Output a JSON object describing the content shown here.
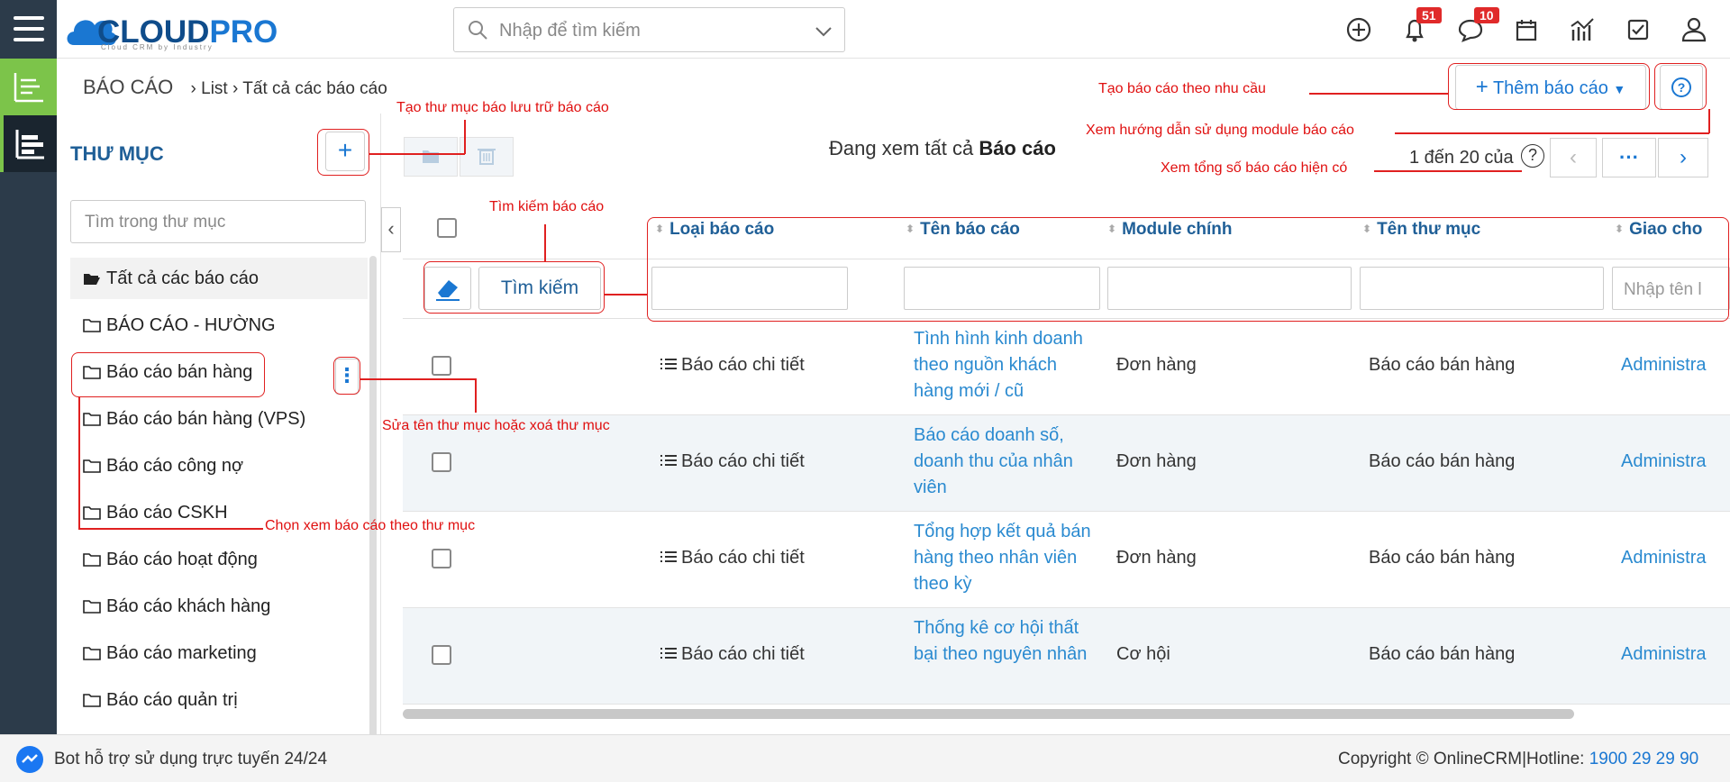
{
  "app": {
    "logo_main": "CLOUD",
    "logo_accent": "PRO",
    "logo_sub": "Cloud CRM by Industry"
  },
  "search": {
    "placeholder": "Nhập để tìm kiếm"
  },
  "top_icons": {
    "notifications_count": "51",
    "messages_count": "10"
  },
  "breadcrumb": {
    "module": "BÁO CÁO",
    "items": [
      "List",
      "Tất cả các báo cáo"
    ]
  },
  "sidebar": {
    "title": "THƯ MỤC",
    "add_label": "+",
    "search_placeholder": "Tìm trong thư mục",
    "folders": [
      "Tất cả các báo cáo",
      "BÁO CÁO - HƯỜNG",
      "Báo cáo bán hàng",
      "Báo cáo bán hàng (VPS)",
      "Báo cáo công nợ",
      "Báo cáo CSKH",
      "Báo cáo hoạt động",
      "Báo cáo khách hàng",
      "Báo cáo marketing",
      "Báo cáo quản trị"
    ]
  },
  "header": {
    "add_report": "Thêm báo cáo",
    "viewing_prefix": "Đang xem tất cả",
    "viewing_module": "Báo cáo",
    "paging": "1 đến 20 của"
  },
  "table": {
    "columns": [
      "Loại báo cáo",
      "Tên báo cáo",
      "Module chính",
      "Tên thư mục",
      "Giao cho"
    ],
    "search_button": "Tìm kiếm",
    "assign_placeholder": "Nhập tên l",
    "rows": [
      {
        "type": "Báo cáo chi tiết",
        "name": "Tình hình kinh doanh theo nguồn khách hàng mới / cũ",
        "module": "Đơn hàng",
        "folder": "Báo cáo bán hàng",
        "assigned": "Administra"
      },
      {
        "type": "Báo cáo chi tiết",
        "name": "Báo cáo doanh số, doanh thu của nhân viên",
        "module": "Đơn hàng",
        "folder": "Báo cáo bán hàng",
        "assigned": "Administra"
      },
      {
        "type": "Báo cáo chi tiết",
        "name": "Tổng hợp kết quả bán hàng theo nhân viên theo kỳ",
        "module": "Đơn hàng",
        "folder": "Báo cáo bán hàng",
        "assigned": "Administra"
      },
      {
        "type": "Báo cáo chi tiết",
        "name": "Thống kê cơ hội thất bại theo nguyên nhân",
        "module": "Cơ hội",
        "folder": "Báo cáo bán hàng",
        "assigned": "Administra"
      }
    ]
  },
  "footer": {
    "bot": "Bot hỗ trợ sử dụng trực tuyến 24/24",
    "copyright": "Copyright © OnlineCRM|Hotline: ",
    "hotline": "1900 29 29 90"
  },
  "annotations": {
    "create_folder": "Tạo thư mục báo lưu trữ báo cáo",
    "create_report": "Tạo báo cáo theo nhu cầu",
    "guide": "Xem hướng dẫn sử dụng module báo cáo",
    "total": "Xem tổng số báo cáo hiện có",
    "search_report": "Tìm kiếm báo cáo",
    "rename_folder": "Sửa tên thư mục hoặc xoá thư mục",
    "choose_folder": "Chọn xem báo cáo theo thư mục"
  },
  "colors": {
    "accent": "#1a77d2",
    "rail": "#2c3b4a",
    "green": "#7cc44a",
    "annotation": "#e02020"
  }
}
